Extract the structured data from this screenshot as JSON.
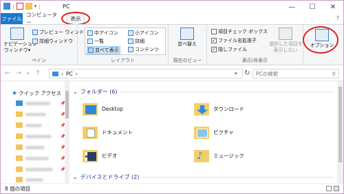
{
  "window": {
    "title": "PC",
    "minimize": "—",
    "maximize": "☐",
    "close": "✕"
  },
  "tabs": {
    "file": "ファイル",
    "computer": "コンピューター",
    "view": "表示"
  },
  "ribbon": {
    "pane_group": {
      "nav_pane": "ナビゲーション\nウィンドウ▾",
      "preview": "プレビュー ウィンドウ",
      "details": "詳細ウィンドウ",
      "label": "ペイン"
    },
    "layout_group": {
      "items": [
        "中アイコン",
        "小アイコン",
        "一覧",
        "詳細",
        "並べて表示",
        "コンテンツ"
      ],
      "label": "レイアウト"
    },
    "current_view_group": {
      "sort": "並べ替え",
      "label": "現在のビュー"
    },
    "show_hide_group": {
      "item_checkbox": "項目チェック ボックス",
      "file_ext": "ファイル名拡張子",
      "hidden_files": "隠しファイル",
      "hide_selected": "選択した項目を\n表示しない",
      "label": "表示/非表示"
    },
    "options": "オプション"
  },
  "address": {
    "path_root": "PC",
    "search_placeholder": "PCの検索"
  },
  "navpane": {
    "quick_access": "クイック アクセス"
  },
  "sections": {
    "folders": "フォルダー (6)",
    "devices": "デバイスとドライブ (2)"
  },
  "folders": [
    "Desktop",
    "ダウンロード",
    "ドキュメント",
    "ピクチャ",
    "ビデオ",
    "ミュージック"
  ],
  "status": {
    "count": "8 個の項目"
  },
  "colors": {
    "accent": "#1979ca",
    "highlight": "#e02020",
    "folder": "#f3cf6b"
  }
}
